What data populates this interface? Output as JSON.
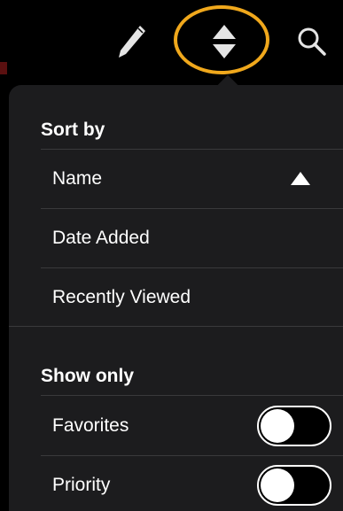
{
  "toolbar": {
    "edit_icon": "pencil-icon",
    "sort_icon": "sort-up-down-icon",
    "search_icon": "search-icon",
    "highlight_color": "#F0A81C"
  },
  "sort_by": {
    "header": "Sort by",
    "options": [
      {
        "label": "Name",
        "selected": true,
        "direction": "ascending"
      },
      {
        "label": "Date Added",
        "selected": false
      },
      {
        "label": "Recently Viewed",
        "selected": false
      }
    ]
  },
  "show_only": {
    "header": "Show only",
    "filters": [
      {
        "label": "Favorites",
        "enabled": false
      },
      {
        "label": "Priority",
        "enabled": false
      }
    ]
  },
  "colors": {
    "background": "#000000",
    "panel": "#1C1C1E",
    "separator": "#3A3A3C",
    "text": "#FFFFFF"
  }
}
